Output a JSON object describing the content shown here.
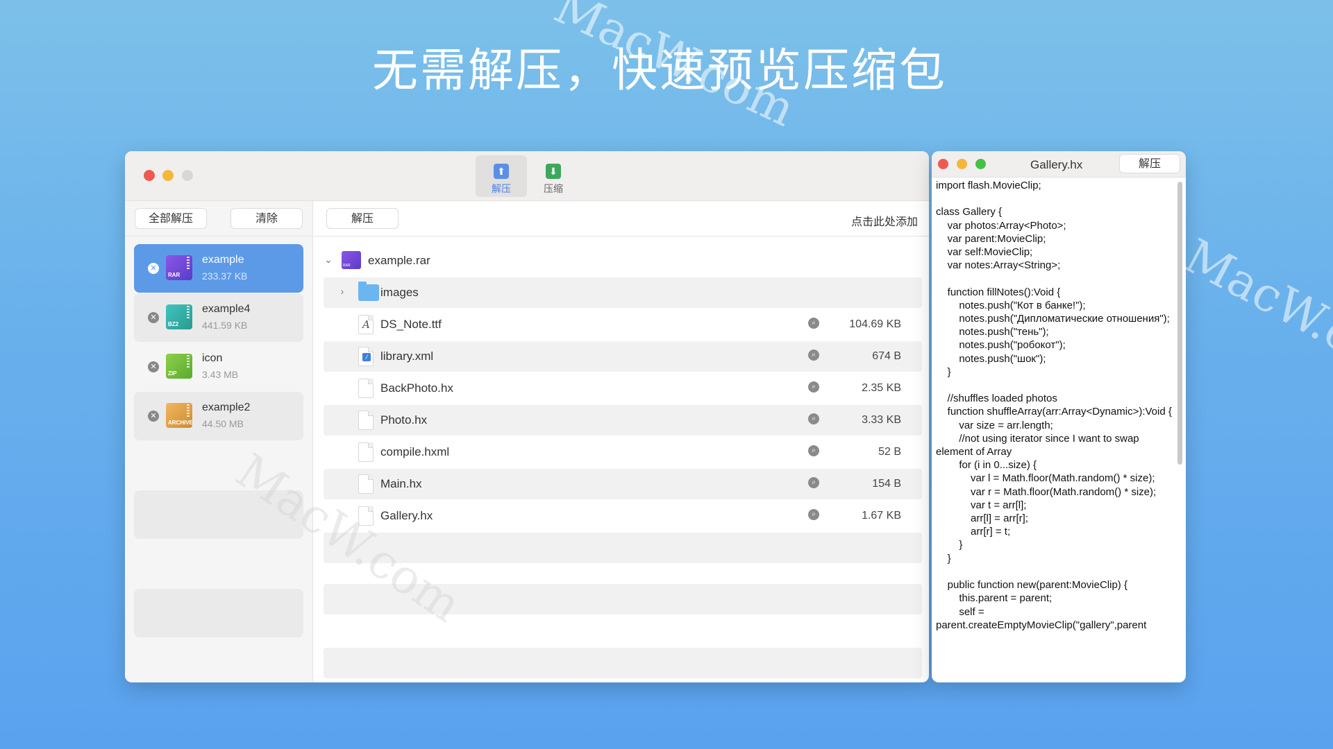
{
  "headline": "无需解压，快速预览压缩包",
  "watermark": "MacW.com",
  "toolbar": {
    "extract_label": "解压",
    "compress_label": "压缩"
  },
  "sidebar": {
    "extract_all_label": "全部解压",
    "clear_label": "清除",
    "archives": [
      {
        "name": "example",
        "size": "233.37 KB",
        "type_badge": "RAR",
        "selected": true
      },
      {
        "name": "example4",
        "size": "441.59 KB",
        "type_badge": "BZ2",
        "selected": false
      },
      {
        "name": "icon",
        "size": "3.43 MB",
        "type_badge": "ZIP",
        "selected": false
      },
      {
        "name": "example2",
        "size": "44.50 MB",
        "type_badge": "ARCHIVE",
        "selected": false
      }
    ]
  },
  "content": {
    "extract_label": "解压",
    "add_link": "点击此处添加",
    "archive_root": "example.rar",
    "folder": "images",
    "files": [
      {
        "name": "DS_Note.ttf",
        "size": "104.69 KB",
        "icon": "font-file-icon"
      },
      {
        "name": "library.xml",
        "size": "674 B",
        "icon": "xml-file-icon"
      },
      {
        "name": "BackPhoto.hx",
        "size": "2.35 KB",
        "icon": "document-icon"
      },
      {
        "name": "Photo.hx",
        "size": "3.33 KB",
        "icon": "document-icon"
      },
      {
        "name": "compile.hxml",
        "size": "52 B",
        "icon": "document-icon"
      },
      {
        "name": "Main.hx",
        "size": "154 B",
        "icon": "document-icon"
      },
      {
        "name": "Gallery.hx",
        "size": "1.67 KB",
        "icon": "document-icon"
      }
    ]
  },
  "preview": {
    "title": "Gallery.hx",
    "extract_label": "解压",
    "code": "import flash.MovieClip;\n\nclass Gallery {\n    var photos:Array<Photo>;\n    var parent:MovieClip;\n    var self:MovieClip;\n    var notes:Array<String>;\n\n    function fillNotes():Void {\n        notes.push(\"Кот в банке!\");\n        notes.push(\"Дипломатические отношения\");\n        notes.push(\"тень\");\n        notes.push(\"робокот\");\n        notes.push(\"шок\");\n    }\n\n    //shuffles loaded photos\n    function shuffleArray(arr:Array<Dynamic>):Void {\n        var size = arr.length;\n        //not using iterator since I want to swap element of Array\n        for (i in 0...size) {\n            var l = Math.floor(Math.random() * size);\n            var r = Math.floor(Math.random() * size);\n            var t = arr[l];\n            arr[l] = arr[r];\n            arr[r] = t;\n        }\n    }\n\n    public function new(parent:MovieClip) {\n        this.parent = parent;\n        self = parent.createEmptyMovieClip(\"gallery\",parent"
  },
  "colors": {
    "accent": "#5c9ae8",
    "background": "#68b0ec"
  }
}
